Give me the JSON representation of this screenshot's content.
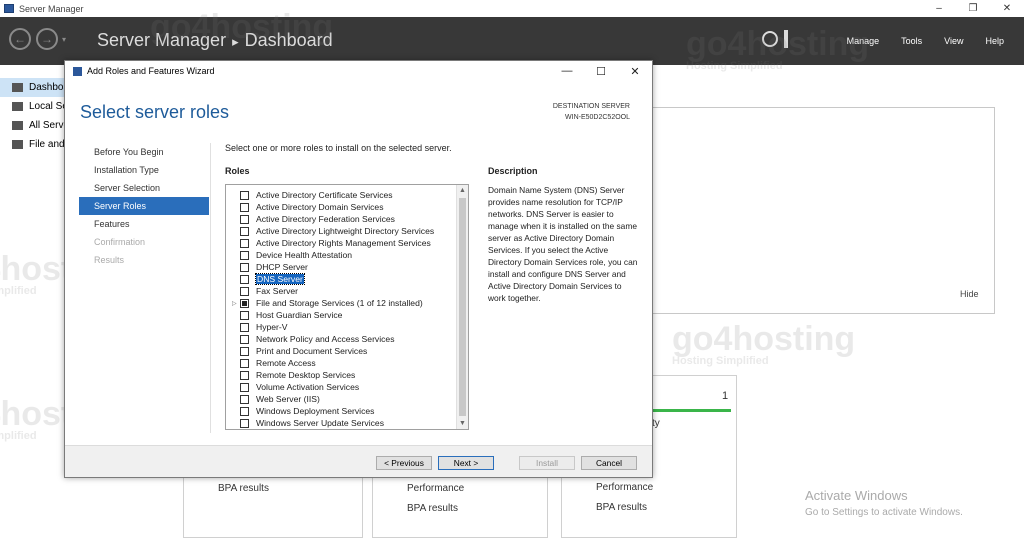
{
  "app": {
    "window_title": "Server Manager",
    "window_controls": [
      "–",
      "❐",
      "✕"
    ]
  },
  "header": {
    "breadcrumb": [
      "Server Manager",
      "Dashboard"
    ],
    "breadcrumb_sep": "▸",
    "nav_back": "←",
    "nav_forward": "→",
    "nav_dropdown": "▾",
    "menu": [
      "Manage",
      "Tools",
      "View",
      "Help"
    ]
  },
  "sidebar": {
    "items": [
      {
        "label": "Dashboard",
        "active": true
      },
      {
        "label": "Local Server",
        "active": false
      },
      {
        "label": "All Servers",
        "active": false
      },
      {
        "label": "File and Storage Services",
        "active": false
      }
    ]
  },
  "main": {
    "hide_label": "Hide",
    "tiles": {
      "tile1": {
        "bpa": "BPA results"
      },
      "tile2": {
        "performance": "Performance",
        "bpa": "BPA results"
      },
      "tile3": {
        "count": "1",
        "partial_label": "ty",
        "performance": "Performance",
        "bpa": "BPA results"
      }
    },
    "activate_title": "Activate Windows",
    "activate_sub": "Go to Settings to activate Windows."
  },
  "watermark": {
    "brand": "go4hosting",
    "tagline": "Hosting Simplified"
  },
  "wizard": {
    "title": "Add Roles and Features Wizard",
    "controls": [
      "—",
      "☐",
      "✕"
    ],
    "heading": "Select server roles",
    "destination_label": "DESTINATION SERVER",
    "destination_name": "WIN-E50D2C52OOL",
    "steps": [
      {
        "label": "Before You Begin",
        "state": "normal"
      },
      {
        "label": "Installation Type",
        "state": "normal"
      },
      {
        "label": "Server Selection",
        "state": "normal"
      },
      {
        "label": "Server Roles",
        "state": "active"
      },
      {
        "label": "Features",
        "state": "normal"
      },
      {
        "label": "Confirmation",
        "state": "disabled"
      },
      {
        "label": "Results",
        "state": "disabled"
      }
    ],
    "intro": "Select one or more roles to install on the selected server.",
    "roles_label": "Roles",
    "roles": [
      {
        "label": "Active Directory Certificate Services",
        "checked": false,
        "expand": false
      },
      {
        "label": "Active Directory Domain Services",
        "checked": false,
        "expand": false
      },
      {
        "label": "Active Directory Federation Services",
        "checked": false,
        "expand": false
      },
      {
        "label": "Active Directory Lightweight Directory Services",
        "checked": false,
        "expand": false
      },
      {
        "label": "Active Directory Rights Management Services",
        "checked": false,
        "expand": false
      },
      {
        "label": "Device Health Attestation",
        "checked": false,
        "expand": false
      },
      {
        "label": "DHCP Server",
        "checked": false,
        "expand": false
      },
      {
        "label": "DNS Server",
        "checked": false,
        "expand": false,
        "selected": true
      },
      {
        "label": "Fax Server",
        "checked": false,
        "expand": false
      },
      {
        "label": "File and Storage Services (1 of 12 installed)",
        "checked": "partial",
        "expand": true
      },
      {
        "label": "Host Guardian Service",
        "checked": false,
        "expand": false
      },
      {
        "label": "Hyper-V",
        "checked": false,
        "expand": false
      },
      {
        "label": "Network Policy and Access Services",
        "checked": false,
        "expand": false
      },
      {
        "label": "Print and Document Services",
        "checked": false,
        "expand": false
      },
      {
        "label": "Remote Access",
        "checked": false,
        "expand": false
      },
      {
        "label": "Remote Desktop Services",
        "checked": false,
        "expand": false
      },
      {
        "label": "Volume Activation Services",
        "checked": false,
        "expand": false
      },
      {
        "label": "Web Server (IIS)",
        "checked": false,
        "expand": false
      },
      {
        "label": "Windows Deployment Services",
        "checked": false,
        "expand": false
      },
      {
        "label": "Windows Server Update Services",
        "checked": false,
        "expand": false
      }
    ],
    "description_label": "Description",
    "description_text": "Domain Name System (DNS) Server provides name resolution for TCP/IP networks. DNS Server is easier to manage when it is installed on the same server as Active Directory Domain Services. If you select the Active Directory Domain Services role, you can install and configure DNS Server and Active Directory Domain Services to work together.",
    "buttons": {
      "previous": "< Previous",
      "next": "Next >",
      "install": "Install",
      "cancel": "Cancel"
    }
  }
}
